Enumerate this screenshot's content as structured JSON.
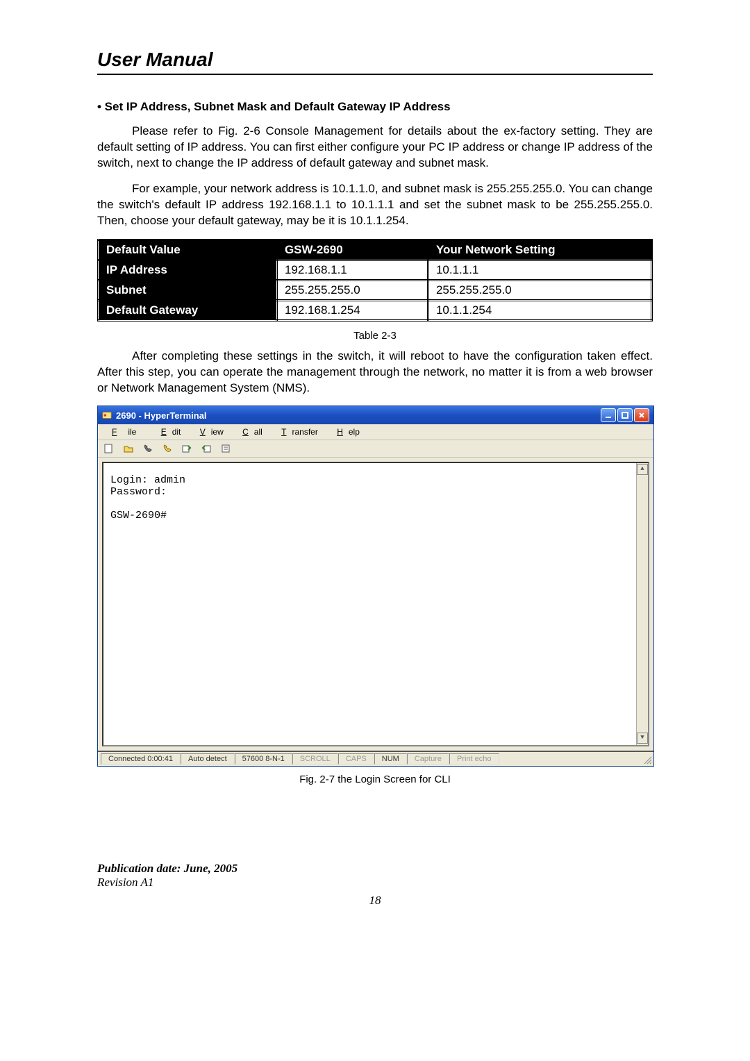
{
  "doc_title": "User Manual",
  "section_heading": "• Set IP Address, Subnet Mask and Default Gateway IP Address",
  "para1": "Please refer to Fig. 2-6 Console Management for details about the ex-factory setting. They are default setting of IP address. You can first either configure your PC IP address or change IP address of the switch, next to change the IP address of default gateway and subnet mask.",
  "para2": "For example, your network address is 10.1.1.0, and subnet mask is 255.255.255.0. You can change the switch's default IP address 192.168.1.1 to 10.1.1.1 and set the subnet mask to be 255.255.255.0. Then, choose your default gateway, may be it is 10.1.1.254.",
  "table": {
    "headers": [
      "Default  Value",
      "GSW-2690",
      "Your Network Setting"
    ],
    "rows": [
      {
        "label": "IP Address",
        "col2": "192.168.1.1",
        "col3": "10.1.1.1"
      },
      {
        "label": "Subnet",
        "col2": "255.255.255.0",
        "col3": "255.255.255.0"
      },
      {
        "label": "Default Gateway",
        "col2": "192.168.1.254",
        "col3": "10.1.1.254"
      }
    ],
    "caption": "Table 2-3"
  },
  "para3": "After completing these settings in the switch, it will reboot to have the configuration taken effect. After this step, you can operate the management through the network, no matter it is from a web browser or Network Management System (NMS).",
  "window": {
    "title": "2690 - HyperTerminal",
    "menus": {
      "file": "File",
      "edit": "Edit",
      "view": "View",
      "call": "Call",
      "transfer": "Transfer",
      "help": "Help"
    },
    "terminal": {
      "line1": "Login: admin",
      "line2": "Password:",
      "line3": "GSW-2690#"
    },
    "status": {
      "connected": "Connected 0:00:41",
      "detect": "Auto detect",
      "params": "57600 8-N-1",
      "scroll": "SCROLL",
      "caps": "CAPS",
      "num": "NUM",
      "capture": "Capture",
      "printecho": "Print echo"
    }
  },
  "fig_caption": "Fig. 2-7 the Login Screen for CLI",
  "footer": {
    "publication": "Publication date: June, 2005",
    "revision": "Revision A1"
  },
  "page_number": "18"
}
